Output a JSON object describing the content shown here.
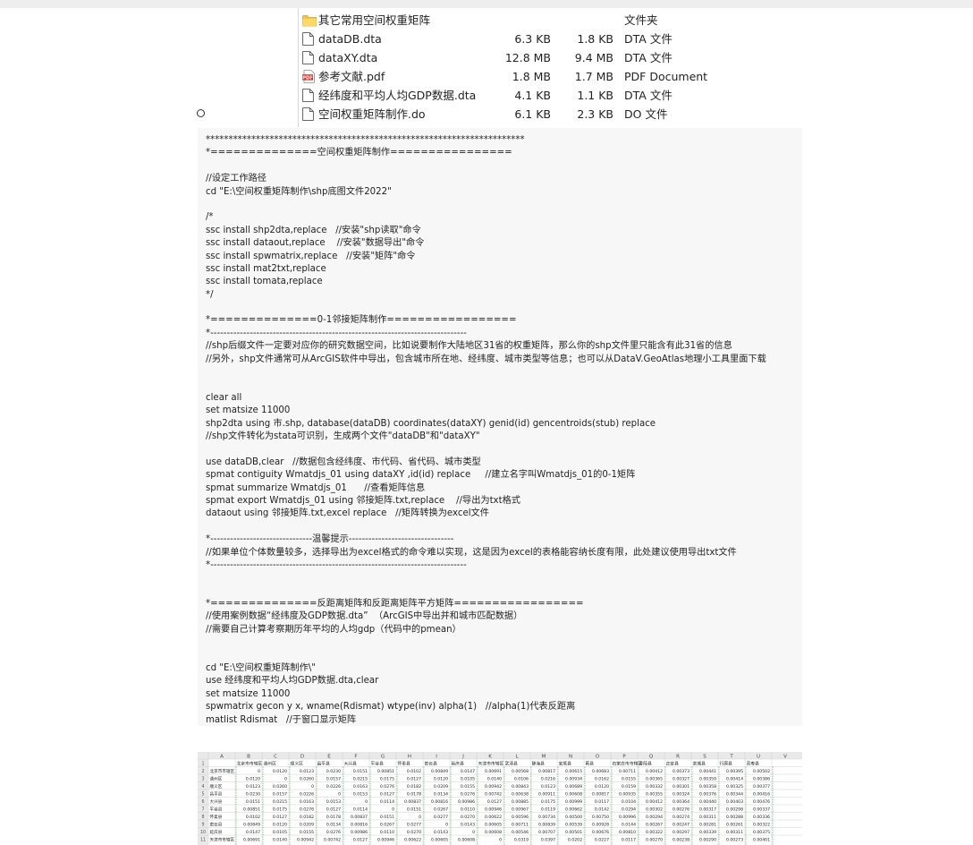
{
  "files": [
    {
      "icon": "folder-icon",
      "name": "其它常用空间权重矩阵",
      "size": "",
      "compressed": "",
      "type": "文件夹"
    },
    {
      "icon": "document-icon",
      "name": "dataDB.dta",
      "size": "6.3 KB",
      "compressed": "1.8 KB",
      "type": "DTA 文件"
    },
    {
      "icon": "document-icon",
      "name": "dataXY.dta",
      "size": "12.8 MB",
      "compressed": "9.4 MB",
      "type": "DTA 文件"
    },
    {
      "icon": "pdf-icon",
      "name": "参考文献.pdf",
      "size": "1.8 MB",
      "compressed": "1.7 MB",
      "type": "PDF Document"
    },
    {
      "icon": "document-icon",
      "name": "经纬度和平均人均GDP数据.dta",
      "size": "4.1 KB",
      "compressed": "1.1 KB",
      "type": "DTA 文件"
    },
    {
      "icon": "document-icon",
      "name": "空间权重矩阵制作.do",
      "size": "6.1 KB",
      "compressed": "2.3 KB",
      "type": "DO 文件"
    }
  ],
  "code_lines": [
    "**********************************************************************",
    "*==============空间权重矩阵制作================",
    "",
    "//设定工作路径",
    "cd \"E:\\空间权重矩阵制作\\shp底图文件2022\"",
    "",
    "/*",
    "ssc install shp2dta,replace   //安装\"shp读取\"命令",
    "ssc install dataout,replace    //安装\"数据导出\"命令",
    "ssc install spwmatrix,replace   //安装\"矩阵\"命令",
    "ssc install mat2txt,replace",
    "ssc install tomata,replace",
    "*/",
    "",
    "*==============0-1邻接矩阵制作=================",
    "*------------------------------------------------------------------------------",
    "//shp后缀文件一定要对应你的研究数据空间，比如说要制作大陆地区31省的权重矩阵，那么你的shp文件里只能含有此31省的信息",
    "//另外，shp文件通常可从ArcGIS软件中导出，包含城市所在地、经纬度、城市类型等信息；也可以从DataV.GeoAtlas地理小工具里面下载",
    "",
    "",
    "clear all",
    "set matsize 11000",
    "shp2dta using 市.shp, database(dataDB) coordinates(dataXY) genid(id) gencentroids(stub) replace",
    "//shp文件转化为stata可识别，生成两个文件\"dataDB\"和\"dataXY\"",
    "",
    "use dataDB,clear   //数据包含经纬度、市代码、省代码、城市类型",
    "spmat contiguity Wmatdjs_01 using dataXY ,id(id) replace     //建立名字叫Wmatdjs_01的0-1矩阵",
    "spmat summarize Wmatdjs_01      //查看矩阵信息",
    "spmat export Wmatdjs_01 using 邻接矩阵.txt,replace    //导出为txt格式",
    "dataout using 邻接矩阵.txt,excel replace   //矩阵转换为excel文件",
    "",
    "*-------------------------------温馨提示--------------------------------",
    "//如果单位个体数量较多，选择导出为excel格式的命令难以实现，这是因为excel的表格能容纳长度有限，此处建议使用导出txt文件",
    "*------------------------------------------------------------------------------",
    "",
    "",
    "*==============反距离矩阵和反距离矩阵平方矩阵=================",
    "//使用案例数据“经纬度及GDP数据.dta”  （ArcGIS中导出并和城市匹配数据）",
    "//需要自己计算考察期历年平均的人均gdp（代码中的pmean）",
    "",
    "",
    "cd \"E:\\空间权重矩阵制作\\\"",
    "use 经纬度和平均人均GDP数据.dta,clear",
    "set matsize 11000",
    "spwmatrix gecon y x, wname(Rdismat) wtype(inv) alpha(1)   //alpha(1)代表反距离",
    "matlist Rdismat   //于窗口显示矩阵"
  ],
  "sheet": {
    "columns": [
      "A",
      "B",
      "C",
      "D",
      "E",
      "F",
      "G",
      "H",
      "I",
      "J",
      "K",
      "L",
      "M",
      "N",
      "O",
      "P",
      "Q",
      "R",
      "S",
      "T",
      "U",
      "V"
    ],
    "header_row": [
      "",
      "北京市市辖区",
      "通州区",
      "顺义区",
      "昌平县",
      "大兴县",
      "平谷县",
      "怀柔县",
      "密云县",
      "延庆县",
      "天津市市辖区",
      "武清县",
      "静海县",
      "宝坻县",
      "蓟县",
      "石家庄市市辖区",
      "井陉县",
      "正定县",
      "栾城县",
      "行唐县",
      "灵寿县"
    ],
    "rows": [
      [
        "北京市市辖区",
        "0",
        "0.0120",
        "0.0123",
        "0.0230",
        "0.0151",
        "0.00851",
        "0.0102",
        "0.00849",
        "0.0147",
        "0.00691",
        "0.00568",
        "0.00817",
        "0.00615",
        "0.00683",
        "0.00711",
        "0.00412",
        "0.00373",
        "0.00441",
        "0.00395",
        "0.00502"
      ],
      [
        "通州区",
        "0.0120",
        "0",
        "0.0260",
        "0.0157",
        "0.0215",
        "0.0175",
        "0.0127",
        "0.0120",
        "0.0105",
        "0.0140",
        "0.0106",
        "0.0216",
        "0.00934",
        "0.0162",
        "0.0155",
        "0.00365",
        "0.00327",
        "0.00359",
        "0.00414",
        "0.00386"
      ],
      [
        "顺义区",
        "0.0123",
        "0.0260",
        "0",
        "0.0226",
        "0.0163",
        "0.0276",
        "0.0182",
        "0.0209",
        "0.0155",
        "0.00942",
        "0.00843",
        "0.0123",
        "0.00689",
        "0.0120",
        "0.0159",
        "0.00332",
        "0.00301",
        "0.00358",
        "0.00325",
        "0.00377"
      ],
      [
        "昌平县",
        "0.0230",
        "0.0157",
        "0.0226",
        "0",
        "0.0153",
        "0.0127",
        "0.0178",
        "0.0134",
        "0.0276",
        "0.00742",
        "0.00638",
        "0.00911",
        "0.00608",
        "0.00817",
        "0.00935",
        "0.00355",
        "0.00324",
        "0.00376",
        "0.00344",
        "0.00416"
      ],
      [
        "大兴县",
        "0.0151",
        "0.0215",
        "0.0163",
        "0.0153",
        "0",
        "0.0114",
        "0.00837",
        "0.00816",
        "0.00986",
        "0.0127",
        "0.00885",
        "0.0175",
        "0.00999",
        "0.0117",
        "0.0104",
        "0.00412",
        "0.00364",
        "0.00440",
        "0.00403",
        "0.00476"
      ],
      [
        "平谷县",
        "0.00851",
        "0.0175",
        "0.0276",
        "0.0127",
        "0.0114",
        "0",
        "0.0151",
        "0.0267",
        "0.0110",
        "0.00946",
        "0.00967",
        "0.0119",
        "0.00662",
        "0.0142",
        "0.0294",
        "0.00302",
        "0.00276",
        "0.00317",
        "0.00298",
        "0.00337"
      ],
      [
        "怀柔县",
        "0.0102",
        "0.0127",
        "0.0182",
        "0.0178",
        "0.00837",
        "0.0151",
        "0",
        "0.0277",
        "0.0270",
        "0.00622",
        "0.00596",
        "0.00734",
        "0.00500",
        "0.00750",
        "0.00996",
        "0.00294",
        "0.00274",
        "0.00311",
        "0.00288",
        "0.00336"
      ],
      [
        "密云县",
        "0.00849",
        "0.0120",
        "0.0209",
        "0.0134",
        "0.00816",
        "0.0267",
        "0.0277",
        "0",
        "0.0143",
        "0.00605",
        "0.00711",
        "0.00839",
        "0.00539",
        "0.00928",
        "0.0144",
        "0.00267",
        "0.00247",
        "0.00281",
        "0.00261",
        "0.00322"
      ],
      [
        "延庆县",
        "0.0147",
        "0.0105",
        "0.0155",
        "0.0276",
        "0.00986",
        "0.0110",
        "0.0270",
        "0.0143",
        "0",
        "0.00608",
        "0.00546",
        "0.00707",
        "0.00501",
        "0.00676",
        "0.00810",
        "0.00322",
        "0.00297",
        "0.00339",
        "0.00311",
        "0.00375"
      ],
      [
        "天津市市辖区",
        "0.00691",
        "0.0140",
        "0.00942",
        "0.00742",
        "0.0127",
        "0.00946",
        "0.00622",
        "0.00605",
        "0.00608",
        "0",
        "0.0319",
        "0.0397",
        "0.0202",
        "0.0227",
        "0.0117",
        "0.00270",
        "0.00238",
        "0.00290",
        "0.00273",
        "0.00401"
      ]
    ]
  }
}
